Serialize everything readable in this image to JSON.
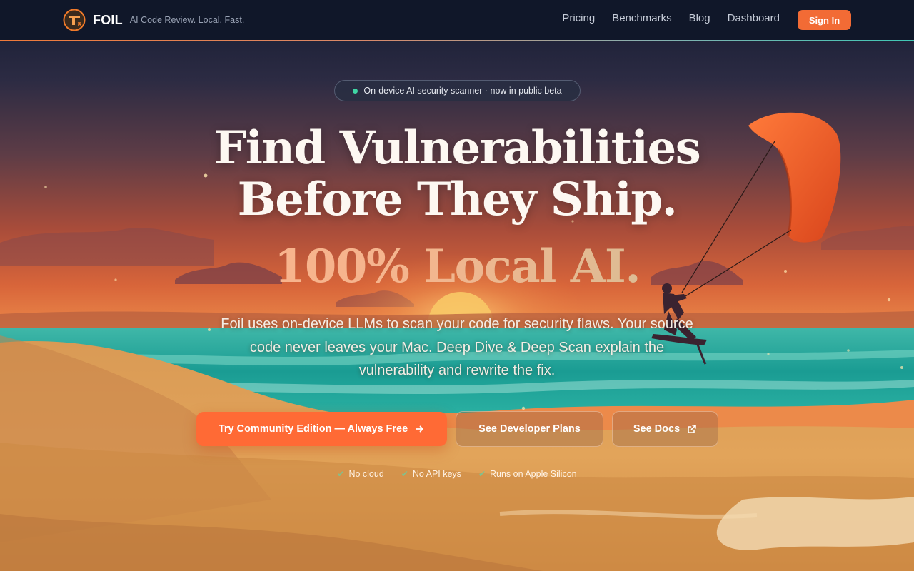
{
  "nav": {
    "brand_name": "FOIL",
    "tagline": "AI Code Review. Local. Fast.",
    "links": [
      "Pricing",
      "Benchmarks",
      "Blog",
      "Dashboard"
    ],
    "signin_label": "Sign In"
  },
  "hero": {
    "badge_text": "On-device AI security scanner · now in public beta",
    "headline_line1": "Find Vulnerabilities",
    "headline_line2": "Before They Ship.",
    "headline_accent": "100% Local AI.",
    "subtext": "Foil uses on-device LLMs to scan your code for security flaws. Your source code never leaves your Mac. Deep Dive & Deep Scan explain the vulnerability and rewrite the fix.",
    "cta_primary": "Try Community Edition — Always Free",
    "cta_plans": "See Developer Plans",
    "cta_docs": "See Docs",
    "checks": [
      "No cloud",
      "No API keys",
      "Runs on Apple Silicon"
    ]
  },
  "colors": {
    "accent": "#ff6a35",
    "nav_bg": "#101729",
    "check": "#7fc28f",
    "badge_dot": "#3fd6a4"
  },
  "icons": {
    "logo": "foil-logo-icon",
    "cta_primary": "arrow-right-icon",
    "cta_docs": "external-link-icon",
    "check": "check-icon"
  }
}
